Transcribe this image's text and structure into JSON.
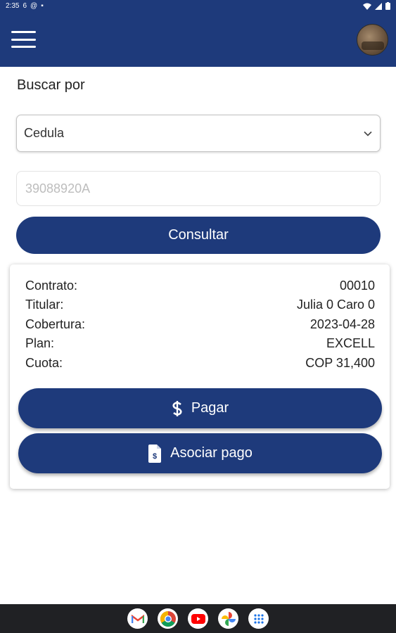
{
  "status_bar": {
    "time": "2:35",
    "notif_icons": [
      "6",
      "@",
      "▪"
    ],
    "right_icons": [
      "wifi-icon",
      "signal-icon",
      "battery-icon"
    ]
  },
  "app_bar": {
    "menu_icon": "hamburger-menu-icon",
    "avatar": "user-avatar"
  },
  "search": {
    "label": "Buscar por",
    "select_value": "Cedula",
    "input_placeholder": "39088920A",
    "consult_label": "Consultar"
  },
  "result": {
    "rows": [
      {
        "label": "Contrato:",
        "value": "00010"
      },
      {
        "label": "Titular:",
        "value": "Julia 0 Caro 0"
      },
      {
        "label": "Cobertura:",
        "value": "2023-04-28"
      },
      {
        "label": "Plan:",
        "value": "EXCELL"
      },
      {
        "label": "Cuota:",
        "value": "COP 31,400"
      }
    ],
    "pay_label": "Pagar",
    "pay_icon": "dollar-icon",
    "associate_label": "Asociar pago",
    "associate_icon": "invoice-icon"
  },
  "dock": {
    "apps": [
      "gmail-icon",
      "chrome-icon",
      "youtube-icon",
      "photos-icon",
      "app-drawer-icon"
    ]
  },
  "colors": {
    "primary": "#1e3a7b",
    "nav_bar": "#202124"
  }
}
